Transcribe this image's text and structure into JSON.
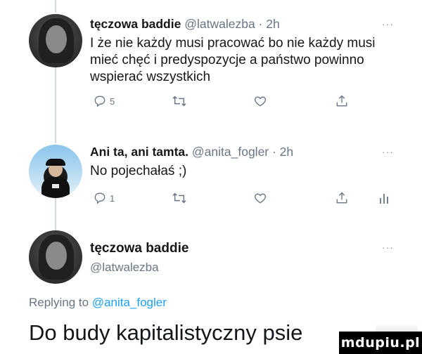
{
  "tweets": [
    {
      "name": "tęczowa baddie",
      "meta": "@latwalezbа · 2h",
      "more": "···",
      "text": "I że nie każdy musi pracować bo nie każdy musi mieć chęć i predyspozycje a państwo powinno wspierać wszystkich",
      "reply_count": "5",
      "retweet_count": "",
      "like_count": ""
    },
    {
      "name": "Ani ta, ani tamta.",
      "meta": "@anita_fogler · 2h",
      "more": "···",
      "text": "No pojechałaś ;)",
      "reply_count": "1",
      "retweet_count": "",
      "like_count": ""
    }
  ],
  "reply": {
    "name": "tęczowa baddie",
    "handle": "@latwalezba",
    "more": "···",
    "replying_prefix": "Replying to",
    "replying_to": "@anita_fogler",
    "text": "Do budy kapitalistyczny psie"
  },
  "watermark": "mdupiu.pl",
  "colors": {
    "text": "#14171a",
    "secondary": "#687684",
    "link": "#1da1f2",
    "thread_line": "#cfd9de"
  },
  "icons": [
    "reply-icon",
    "retweet-icon",
    "like-icon",
    "share-icon",
    "analytics-icon",
    "more-icon"
  ]
}
